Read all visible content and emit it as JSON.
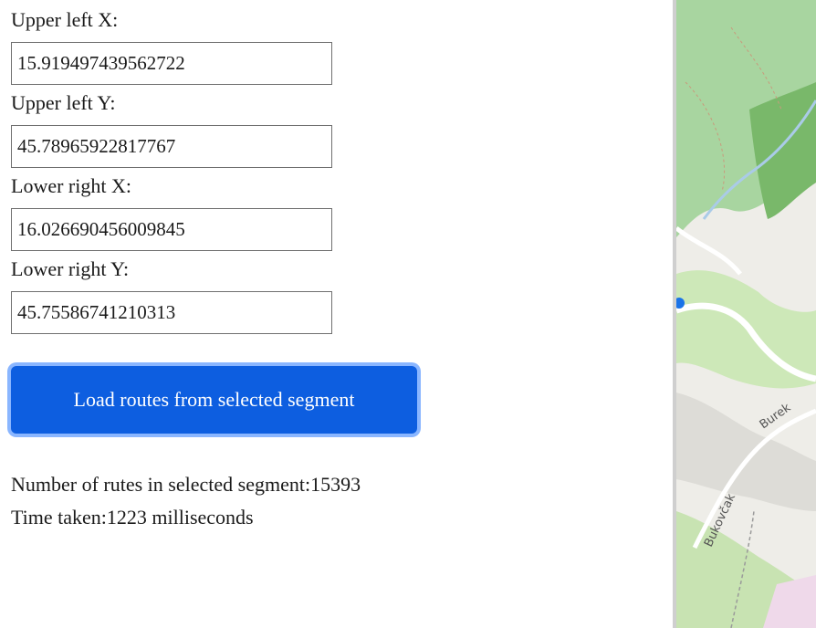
{
  "form": {
    "fields": [
      {
        "label": "Upper left X:",
        "value": "15.919497439562722"
      },
      {
        "label": "Upper left Y:",
        "value": "45.78965922817767"
      },
      {
        "label": "Lower right X:",
        "value": "16.026690456009845"
      },
      {
        "label": "Lower right Y:",
        "value": "45.75586741210313"
      }
    ],
    "load_button_label": "Load routes from selected segment"
  },
  "results": {
    "route_count_text": "Number of rutes in selected segment:15393",
    "time_taken_text": "Time taken:1223 milliseconds"
  },
  "map": {
    "street_labels": [
      "Bukovčak",
      "Burek"
    ],
    "colors": {
      "forest": "#a8d5a0",
      "dense_forest": "#79b86a",
      "meadow": "#cde8b8",
      "urban": "#dddcd7",
      "road": "#ffffff",
      "water": "#aacbe8",
      "marker": "#1a73e8"
    }
  }
}
